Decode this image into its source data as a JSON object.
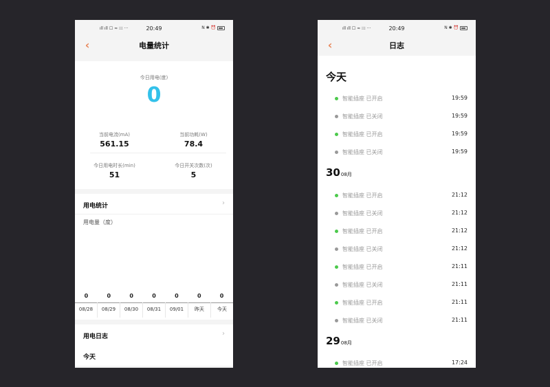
{
  "colors": {
    "accent_blue": "#33c1ea",
    "accent_orange": "#e8875a",
    "on_green": "#4cc94c",
    "off_gray": "#999999"
  },
  "status_bar": {
    "left_icons": "ıll ıll ☐ ≈ ⁝⁝⁝ ···",
    "time": "20:49",
    "right_icons": "N ✱ ⏰"
  },
  "left": {
    "title": "电量统计",
    "today_label": "今日用电(度)",
    "today_value": "0",
    "stats": [
      {
        "label": "当前电流(mA)",
        "value": "561.15"
      },
      {
        "label": "当前功耗(W)",
        "value": "78.4"
      },
      {
        "label": "今日用电时长(min)",
        "value": "51"
      },
      {
        "label": "今日开关次数(次)",
        "value": "5"
      }
    ],
    "usage_section": "用电统计",
    "chart_title": "用电量（度）",
    "log_section": "用电日志",
    "today_row": "今天"
  },
  "chart_data": {
    "type": "bar",
    "title": "用电量（度）",
    "categories": [
      "08/28",
      "08/29",
      "08/30",
      "08/31",
      "09/01",
      "昨天",
      "今天"
    ],
    "values": [
      0,
      0,
      0,
      0,
      0,
      0,
      0
    ],
    "value_labels": [
      "0",
      "0",
      "0",
      "0",
      "0",
      "0",
      "0"
    ]
  },
  "right": {
    "title": "日志",
    "groups": [
      {
        "big": "今天",
        "small": "",
        "entries": [
          {
            "text": "智能插座 已开启",
            "time": "19:59",
            "state": "on"
          },
          {
            "text": "智能插座 已关闭",
            "time": "19:59",
            "state": "off"
          },
          {
            "text": "智能插座 已开启",
            "time": "19:59",
            "state": "on"
          },
          {
            "text": "智能插座 已关闭",
            "time": "19:59",
            "state": "off"
          }
        ]
      },
      {
        "big": "30",
        "small": "08月",
        "entries": [
          {
            "text": "智能插座 已开启",
            "time": "21:12",
            "state": "on"
          },
          {
            "text": "智能插座 已关闭",
            "time": "21:12",
            "state": "off"
          },
          {
            "text": "智能插座 已开启",
            "time": "21:12",
            "state": "on"
          },
          {
            "text": "智能插座 已关闭",
            "time": "21:12",
            "state": "off"
          },
          {
            "text": "智能插座 已开启",
            "time": "21:11",
            "state": "on"
          },
          {
            "text": "智能插座 已关闭",
            "time": "21:11",
            "state": "off"
          },
          {
            "text": "智能插座 已开启",
            "time": "21:11",
            "state": "on"
          },
          {
            "text": "智能插座 已关闭",
            "time": "21:11",
            "state": "off"
          }
        ]
      },
      {
        "big": "29",
        "small": "08月",
        "entries": [
          {
            "text": "智能插座 已开启",
            "time": "17:24",
            "state": "on"
          }
        ]
      }
    ]
  }
}
